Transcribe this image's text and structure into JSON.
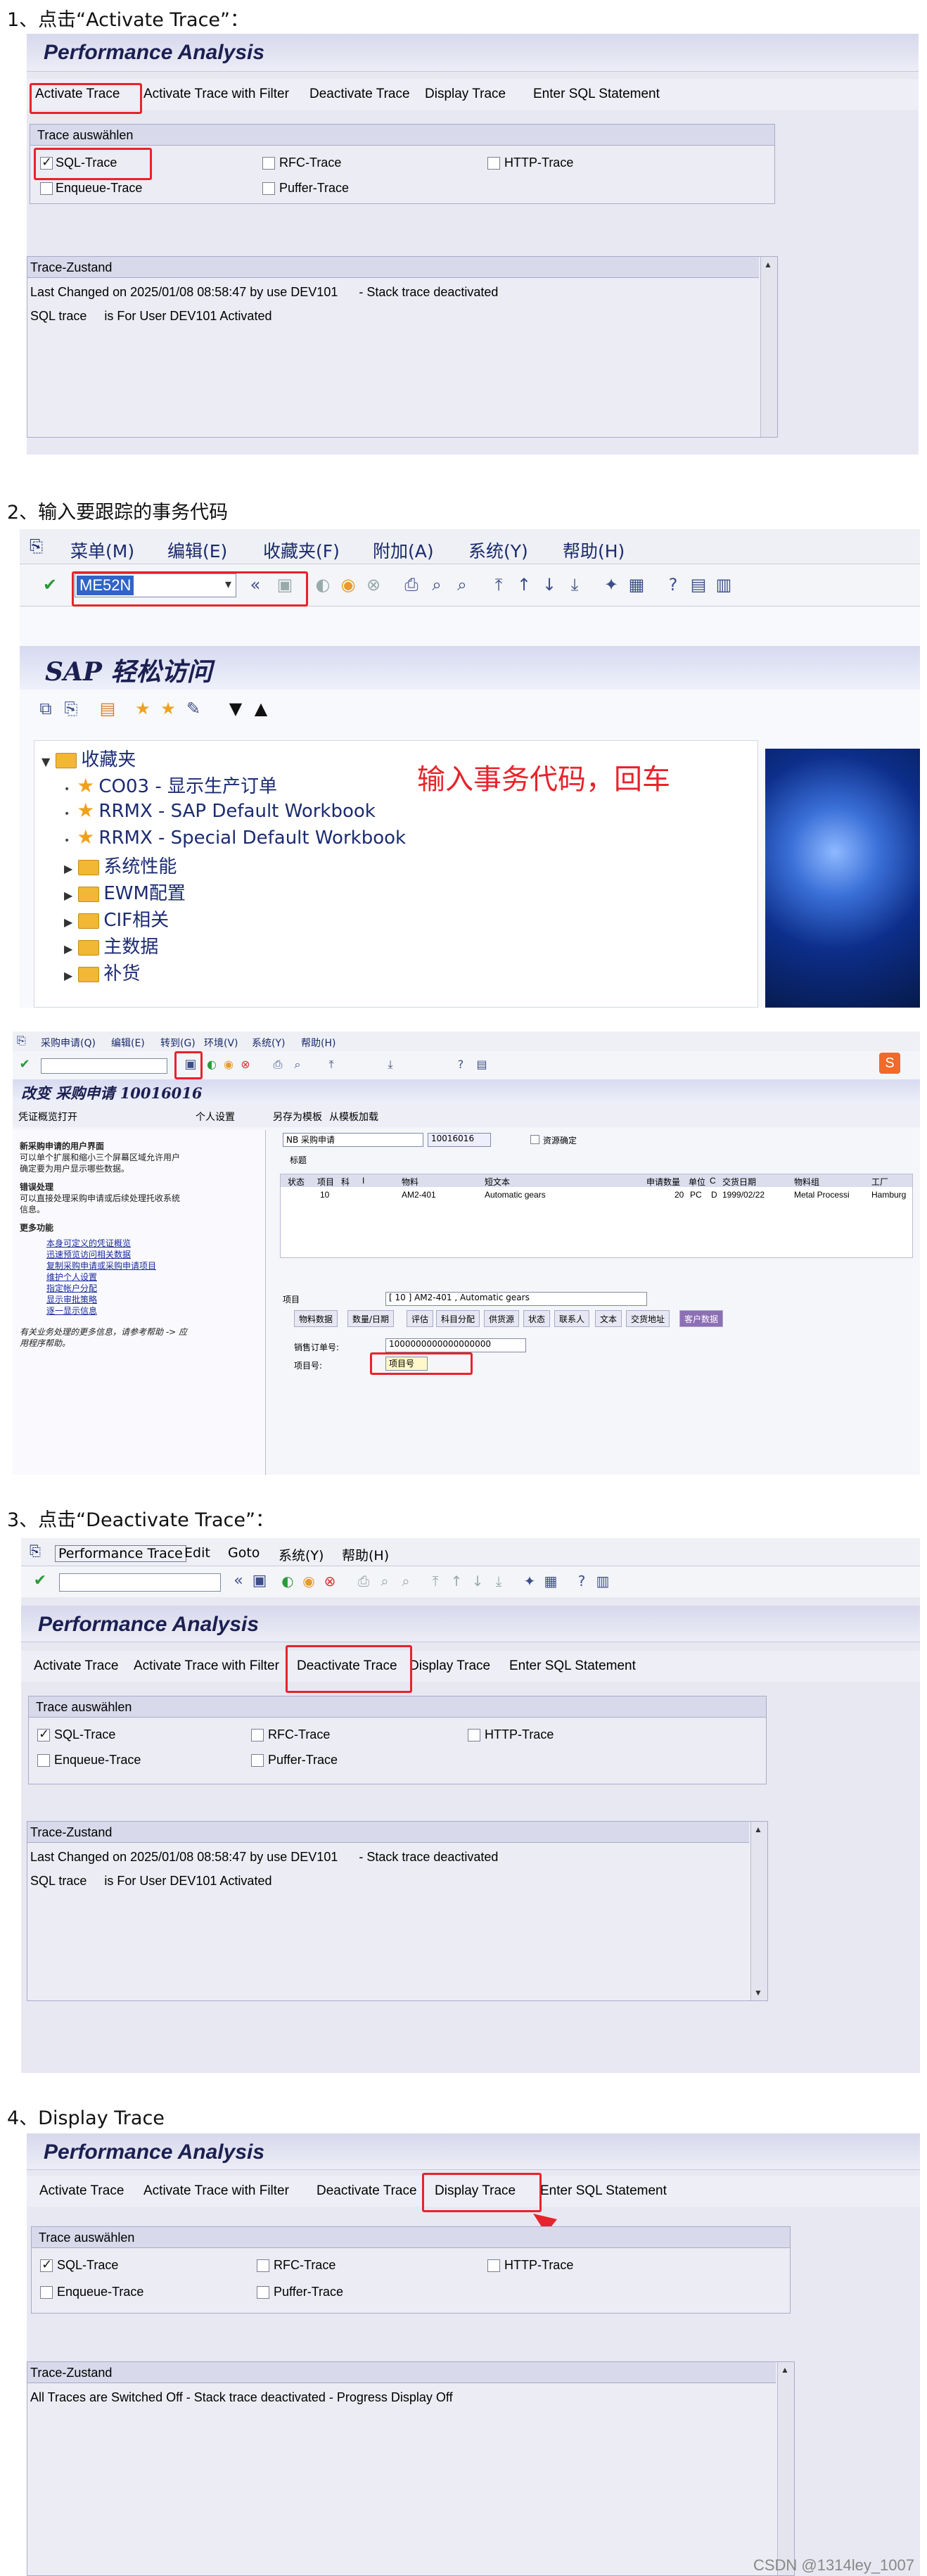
{
  "steps": [
    {
      "label": "1、点击“Activate Trace”："
    },
    {
      "label": "2、输入要跟踪的事务代码"
    },
    {
      "label": "3、点击“Deactivate Trace”："
    },
    {
      "label": "4、Display Trace"
    }
  ],
  "st05": {
    "title": "Performance Analysis",
    "toolbar": [
      "Activate Trace",
      "Activate Trace with Filter",
      "Deactivate Trace",
      "Display Trace",
      "Enter SQL Statement"
    ],
    "group_title": "Trace auswählen",
    "checks": {
      "sql": "SQL-Trace",
      "rfc": "RFC-Trace",
      "http": "HTTP-Trace",
      "enqueue": "Enqueue-Trace",
      "puffer": "Puffer-Trace"
    },
    "status_title": "Trace-Zustand",
    "status_lines_active": [
      "Last Changed on 2025/01/08 08:58:47 by use DEV101      - Stack trace deactivated",
      "SQL trace     is For User DEV101 Activated"
    ],
    "status_lines_off": [
      "All Traces are Switched Off - Stack trace deactivated - Progress Display Off"
    ]
  },
  "panel3_menu": {
    "items": [
      "Performance Trace",
      "Edit",
      "Goto",
      "系统(Y)",
      "帮助(H)"
    ]
  },
  "easy_access": {
    "menu": [
      "菜单(M)",
      "编辑(E)",
      "收藏夹(F)",
      "附加(A)",
      "系统(Y)",
      "帮助(H)"
    ],
    "command_value": "ME52N",
    "title": "SAP 轻松访问",
    "favorites_label": "收藏夹",
    "favorites": [
      "CO03 - 显示生产订单",
      "RRMX - SAP Default Workbook",
      "RRMX - Special Default Workbook"
    ],
    "folders": [
      "系统性能",
      "EWM配置",
      "CIF相关",
      "主数据",
      "补货"
    ],
    "annotation": "输入事务代码，回车"
  },
  "me52n": {
    "menu": [
      "采购申请(Q)",
      "编辑(E)",
      "转到(G)",
      "环境(V)",
      "系统(Y)",
      "帮助(H)"
    ],
    "title": "改变 采购申请 10016016",
    "app_buttons": [
      "凭证概览打开",
      "个人设置",
      "另存为模板",
      "从模板加载"
    ],
    "doc_type": "NB 采购申请",
    "doc_number": "10016016",
    "resource_check": "资源确定",
    "header_tab": "标题",
    "help_title": "新采购申请的用户界面",
    "help_body": [
      "可以单个扩展和缩小三个屏幕区域允许用户",
      "确定要为用户显示哪些数据。"
    ],
    "error_title": "错误处理",
    "error_body": [
      "可以直接处理采购申请或后续处理托收系统",
      "信息。"
    ],
    "more_title": "更多功能",
    "links": [
      "本身可定义的凭证概览",
      "迅速预览访问相关数据",
      "复制采购申请或采购申请项目",
      "维护个人设置",
      "指定帐户分配",
      "显示审批策略",
      "逐一显示信息"
    ],
    "footer_help": [
      "有关业务处理的更多信息，请参考帮助 -> 应",
      "用程序帮助。"
    ],
    "columns": [
      "状态",
      "项目",
      "科",
      "I",
      "物料",
      "短文本",
      "申请数量",
      "单位",
      "C",
      "交货日期",
      "物料组",
      "工厂"
    ],
    "row": [
      "",
      "10",
      "",
      "",
      "AM2-401",
      "Automatic gears",
      "20",
      "PC",
      "D",
      "1999/02/22",
      "Metal Processi",
      "Hamburg"
    ],
    "item_label": "项目",
    "item_select": "[ 10 ] AM2-401 , Automatic gears",
    "item_tabs": [
      "物料数据",
      "数量/日期",
      "评估",
      "科目分配",
      "供货源",
      "状态",
      "联系人",
      "文本",
      "交货地址",
      "客户数据"
    ],
    "sales_order_label": "销售订单号:",
    "sales_order_value": "1000000000000000000",
    "item_no_label": "项目号:",
    "item_no_value": "项目号"
  },
  "watermark": "CSDN @1314ley_1007"
}
